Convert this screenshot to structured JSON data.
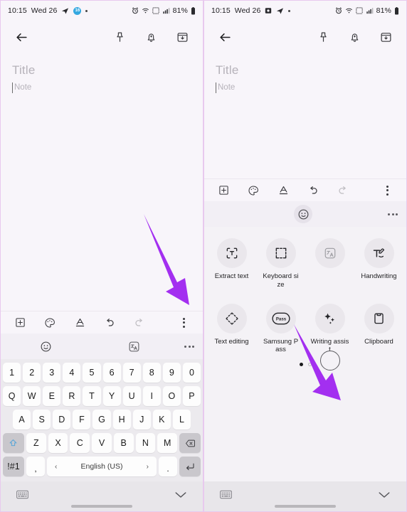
{
  "meta": {
    "accent_purple": "#a32ff0",
    "note_bg": "#f8f5fa",
    "keyboard_bg": "#eceaee",
    "key_bg": "#fdfdfd"
  },
  "status_bar": {
    "time": "10:15",
    "date": "Wed 26",
    "battery": "81%",
    "left_icons_left_panel": [
      "telegram-icon",
      "telegram-badge-icon",
      "dot-icon"
    ],
    "left_icons_right_panel": [
      "screenshot-icon",
      "telegram-icon",
      "dot-icon"
    ],
    "right_icons": [
      "alarm-icon",
      "wifi-calling-icon",
      "nfc-icon",
      "signal-icon",
      "battery-icon"
    ]
  },
  "app_bar": {
    "back_label": "back-arrow",
    "actions": [
      {
        "name": "pin-icon",
        "label": "Pin"
      },
      {
        "name": "reminder-bell-icon",
        "label": "Add reminder"
      },
      {
        "name": "save-note-icon",
        "label": "Save"
      }
    ]
  },
  "note": {
    "title_placeholder": "Title",
    "body_placeholder": "Note"
  },
  "format_toolbar": {
    "items": [
      {
        "name": "insert-plus-icon",
        "label": "Insert"
      },
      {
        "name": "palette-icon",
        "label": "Drawing colors"
      },
      {
        "name": "text-format-icon",
        "label": "Text format"
      },
      {
        "name": "undo-icon",
        "label": "Undo"
      },
      {
        "name": "redo-icon",
        "label": "Redo",
        "disabled": true
      }
    ],
    "more_left": "more-horizontal-icon",
    "more_right": "more-vertical-icon"
  },
  "suggestion_row": {
    "emoji": "emoji-icon",
    "translate": "translate-icon",
    "more": "more-dots-icon"
  },
  "keyboard": {
    "row_numbers": [
      "1",
      "2",
      "3",
      "4",
      "5",
      "6",
      "7",
      "8",
      "9",
      "0"
    ],
    "row_top": [
      "Q",
      "W",
      "E",
      "R",
      "T",
      "Y",
      "U",
      "I",
      "O",
      "P"
    ],
    "row_mid": [
      "A",
      "S",
      "D",
      "F",
      "G",
      "H",
      "J",
      "K",
      "L"
    ],
    "row_bottom": [
      "Z",
      "X",
      "C",
      "V",
      "B",
      "N",
      "M"
    ],
    "shift_key": "shift-icon",
    "backspace_key": "backspace-icon",
    "symbols_key": "!#1",
    "comma_key": ",",
    "period_key": ".",
    "space_language": "English (US)",
    "space_prev": "‹",
    "space_next": "›",
    "enter_key": "enter-icon"
  },
  "nav_bar": {
    "keyboard_switch": "keyboard-switch-icon",
    "hide_keyboard": "chevron-down-icon"
  },
  "feature_panel": {
    "rows": [
      [
        {
          "name": "extract-text",
          "label": "Extract text",
          "icon": "extract-text-icon"
        },
        {
          "name": "keyboard-size",
          "label": "Keyboard size",
          "icon": "keyboard-size-icon"
        },
        {
          "name": "translate",
          "label": "",
          "icon": "translate-icon"
        },
        {
          "name": "handwriting",
          "label": "Handwriting",
          "icon": "handwriting-icon"
        }
      ],
      [
        {
          "name": "text-editing",
          "label": "Text editing",
          "icon": "text-editing-icon"
        },
        {
          "name": "samsung-pass",
          "label": "Samsung Pass",
          "icon": "samsung-pass-icon",
          "glyph": "Pass"
        },
        {
          "name": "writing-assist",
          "label": "Writing assist",
          "icon": "writing-assist-icon"
        },
        {
          "name": "clipboard",
          "label": "Clipboard",
          "icon": "clipboard-icon"
        }
      ]
    ],
    "page_current": 1,
    "page_total": 2
  },
  "annotations": {
    "left_arrow": {
      "name": "callout-arrow-more-options",
      "color": "#a32ff0"
    },
    "right_arrow": {
      "name": "callout-arrow-writing-assist",
      "color": "#a32ff0"
    },
    "touch_ring": {
      "name": "touch-indicator"
    }
  }
}
